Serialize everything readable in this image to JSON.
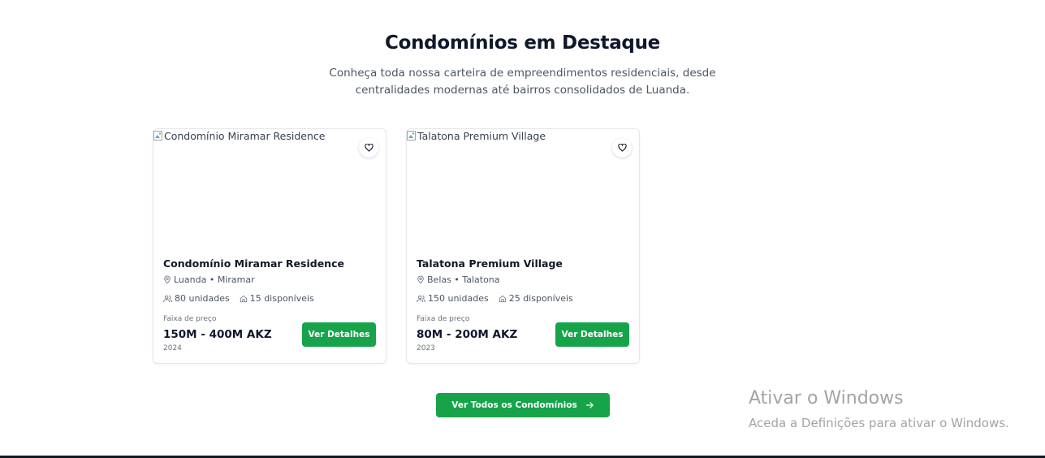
{
  "header": {
    "title": "Condomínios em Destaque",
    "subtitle_line1": "Conheça toda nossa carteira de empreendimentos residenciais, desde",
    "subtitle_line2": "centralidades modernas até bairros consolidados de Luanda."
  },
  "cards": [
    {
      "image_alt": "Condomínio Miramar Residence",
      "name": "Condomínio Miramar Residence",
      "location": "Luanda • Miramar",
      "units": "80 unidades",
      "available": "15 disponíveis",
      "price_label": "Faixa de preço",
      "price": "150M - 400M AKZ",
      "year": "2024",
      "button": "Ver Detalhes"
    },
    {
      "image_alt": "Talatona Premium Village",
      "name": "Talatona Premium Village",
      "location": "Belas • Talatona",
      "units": "150 unidades",
      "available": "25 disponíveis",
      "price_label": "Faixa de preço",
      "price": "80M - 200M AKZ",
      "year": "2023",
      "button": "Ver Detalhes"
    }
  ],
  "all_button": {
    "label": "Ver Todos os Condomínios",
    "icon": "arrow-right-icon"
  },
  "windows_watermark": {
    "title": "Ativar o Windows",
    "subtitle": "Aceda a Definições para ativar o Windows."
  },
  "colors": {
    "accent": "#16a34a",
    "title": "#0f172a",
    "muted": "#4b5563"
  }
}
